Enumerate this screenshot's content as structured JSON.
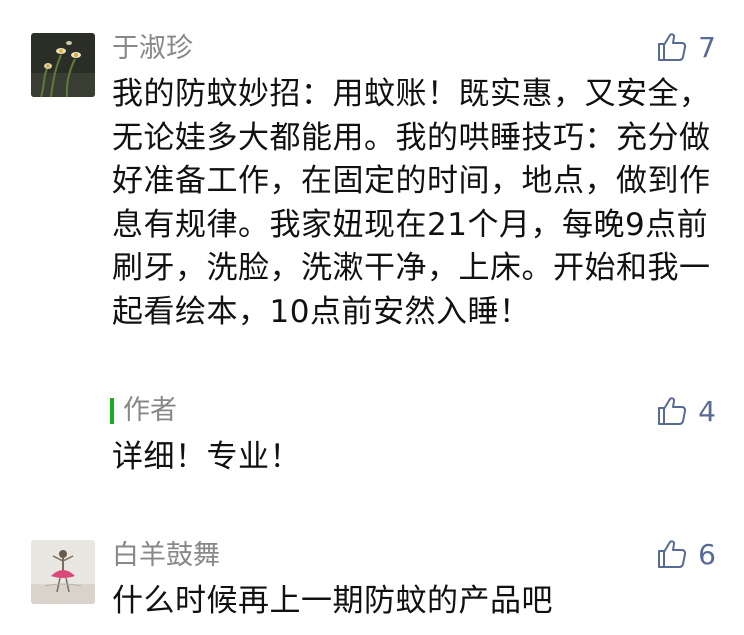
{
  "comments": [
    {
      "nickname": "于淑珍",
      "avatar_icon": "flower-avatar-icon",
      "likes": "7",
      "text": "我的防蚊妙招：用蚊账！既实惠，又安全，无论娃多大都能用。我的哄睡技巧：充分做好准备工作，在固定的时间，地点，做到作息有规律。我家妞现在21个月，每晚9点前刷牙，洗脸，洗漱干净，上床。开始和我一起看绘本，10点前安然入睡！",
      "reply": {
        "author_label": "作者",
        "likes": "4",
        "text": "详细！专业！"
      }
    },
    {
      "nickname": "白羊鼓舞",
      "avatar_icon": "dancer-avatar-icon",
      "likes": "6",
      "text": "什么时候再上一期防蚊的产品吧"
    }
  ],
  "colors": {
    "nickname": "#888888",
    "text": "#111111",
    "like": "#576b95",
    "author_bar": "#1aad19"
  }
}
